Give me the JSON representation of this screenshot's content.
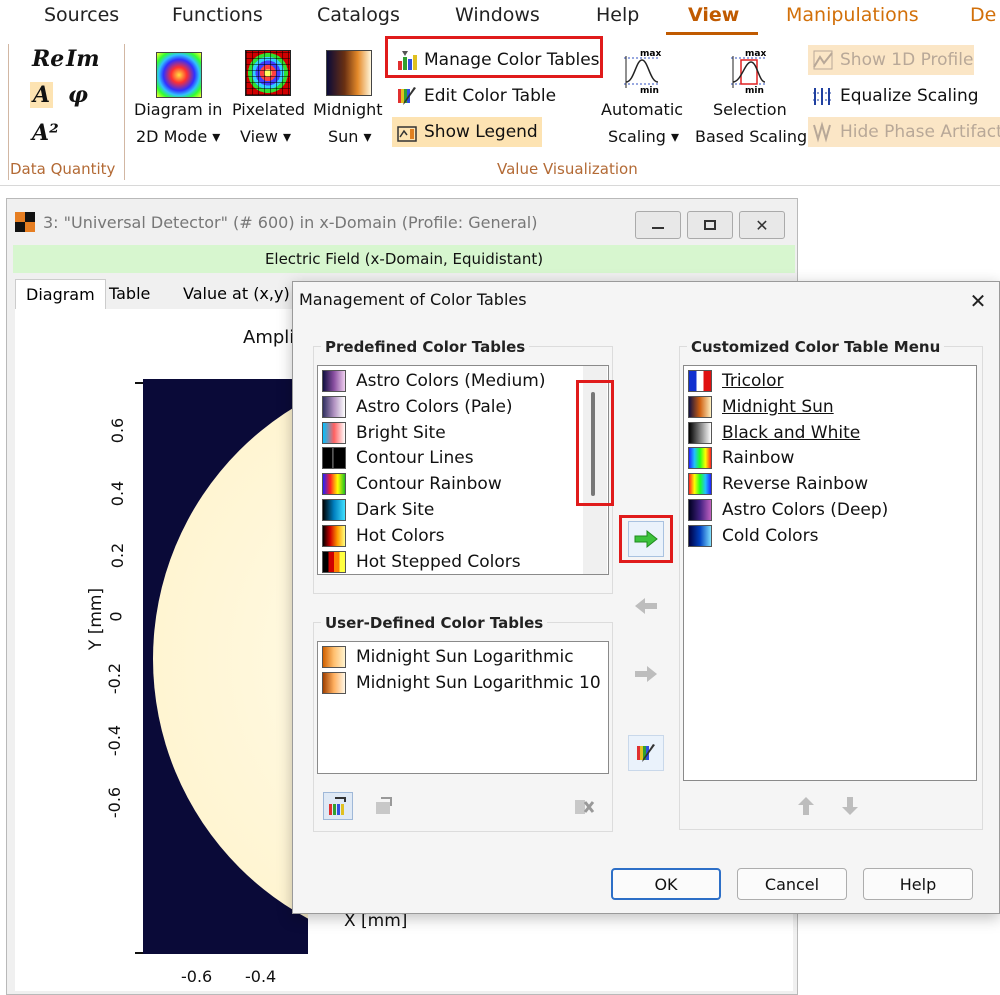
{
  "menubar": {
    "items": [
      "Sources",
      "Functions",
      "Catalogs",
      "Windows",
      "Help",
      "View",
      "Manipulations",
      "De"
    ]
  },
  "ribbon": {
    "data_quantity": {
      "label": "Data Quantity",
      "symbols": [
        "Re",
        "Im",
        "A",
        "φ",
        "A²"
      ]
    },
    "value_visualization": {
      "label": "Value Visualization",
      "diagram_2d": [
        "Diagram in",
        "2D Mode ▾"
      ],
      "pixelated": [
        "Pixelated",
        "View ▾"
      ],
      "midnight": [
        "Midnight",
        "Sun ▾"
      ],
      "manage_color_tables": "Manage Color Tables",
      "edit_color_table": "Edit Color Table",
      "show_legend": "Show Legend",
      "automatic_scaling": [
        "Automatic",
        "Scaling ▾"
      ],
      "selection_scaling": [
        "Selection",
        "Based Scaling"
      ],
      "show_1d_profile": "Show 1D Profile",
      "equalize_scaling": "Equalize Scaling",
      "hide_phase_artifacts": "Hide Phase Artifacts"
    },
    "icon_glyphs": {
      "max": "max",
      "min": "min"
    }
  },
  "docwin": {
    "title": "3: \"Universal Detector\" (# 600) in x-Domain (Profile: General)",
    "banner": "Electric Field (x-Domain, Equidistant)",
    "tabs": [
      "Diagram",
      "Table",
      "Value at (x,y)"
    ],
    "plot_title": "Amplit",
    "ylabel": "Y [mm]",
    "xlabel": "X [mm]",
    "yticks": [
      "0.6",
      "0.4",
      "0.2",
      "0",
      "-0.2",
      "-0.4",
      "-0.6"
    ],
    "xticks": [
      "-0.6",
      "-0.4"
    ]
  },
  "dialog": {
    "title": "Management of Color Tables",
    "close": "✕",
    "predefined_label": "Predefined Color Tables",
    "predefined": [
      {
        "name": "Astro Colors (Medium)",
        "grad": "linear-gradient(90deg,#101040,#8a4fa0,#f0d0f0)"
      },
      {
        "name": "Astro Colors (Pale)",
        "grad": "linear-gradient(90deg,#303060,#b090c0,#ffffff)"
      },
      {
        "name": "Bright Site",
        "grad": "linear-gradient(90deg,#00c0ff,#ff6060,#ffffff)"
      },
      {
        "name": "Contour Lines",
        "grad": "linear-gradient(90deg,#000,#000 40%,#888 45%,#000 50%,#000)"
      },
      {
        "name": "Contour Rainbow",
        "grad": "linear-gradient(90deg,#2020ff,#ff2020,#ffff00,#20c020)"
      },
      {
        "name": "Dark Site",
        "grad": "linear-gradient(90deg,#000,#0080c0,#40e0ff)"
      },
      {
        "name": "Hot Colors",
        "grad": "linear-gradient(90deg,#000,#d00000,#ffa000,#ffff80)"
      },
      {
        "name": "Hot Stepped Colors",
        "grad": "linear-gradient(90deg,#000 25%,#d00000 25% 50%,#ff8000 50% 75%,#ffff40 75%)"
      }
    ],
    "user_label": "User-Defined Color Tables",
    "user_defined": [
      {
        "name": "Midnight Sun Logarithmic",
        "grad": "linear-gradient(90deg,#d06000,#ffc070,#fff4d0)"
      },
      {
        "name": "Midnight Sun Logarithmic 10",
        "grad": "linear-gradient(90deg,#a04000,#ffb060,#fff8e8)"
      }
    ],
    "custom_label": "Customized Color Table Menu",
    "custom": [
      {
        "name": "Tricolor",
        "grad": "linear-gradient(90deg,#1030d0 33%,#ffffff 33% 66%,#e01010 66%)",
        "underlined": true
      },
      {
        "name": "Midnight Sun",
        "grad": "linear-gradient(90deg,#101040,#d06010,#fff0c0)",
        "underlined": true
      },
      {
        "name": "Black and White",
        "grad": "linear-gradient(90deg,#000,#fff)",
        "underlined": true
      },
      {
        "name": "Rainbow",
        "grad": "linear-gradient(90deg,#2020ff,#20c0ff,#20ff20,#ffff00,#ff2020)",
        "underlined": false
      },
      {
        "name": "Reverse Rainbow",
        "grad": "linear-gradient(90deg,#ff2020,#ffff00,#20ff20,#20c0ff,#2020ff)",
        "underlined": false
      },
      {
        "name": "Astro Colors (Deep)",
        "grad": "linear-gradient(90deg,#000020,#402080,#c060c0)",
        "underlined": false
      },
      {
        "name": "Cold Colors",
        "grad": "linear-gradient(90deg,#000040,#0040c0,#80e0ff)",
        "underlined": false
      }
    ],
    "ok": "OK",
    "cancel": "Cancel",
    "help": "Help"
  },
  "colors": {
    "accent_orange": "#c05a00",
    "highlight_fill": "#fde3b2",
    "banner_green": "#d7f6cf",
    "annotation_red": "#e01b1b",
    "arrow_green": "#3cc23c"
  }
}
